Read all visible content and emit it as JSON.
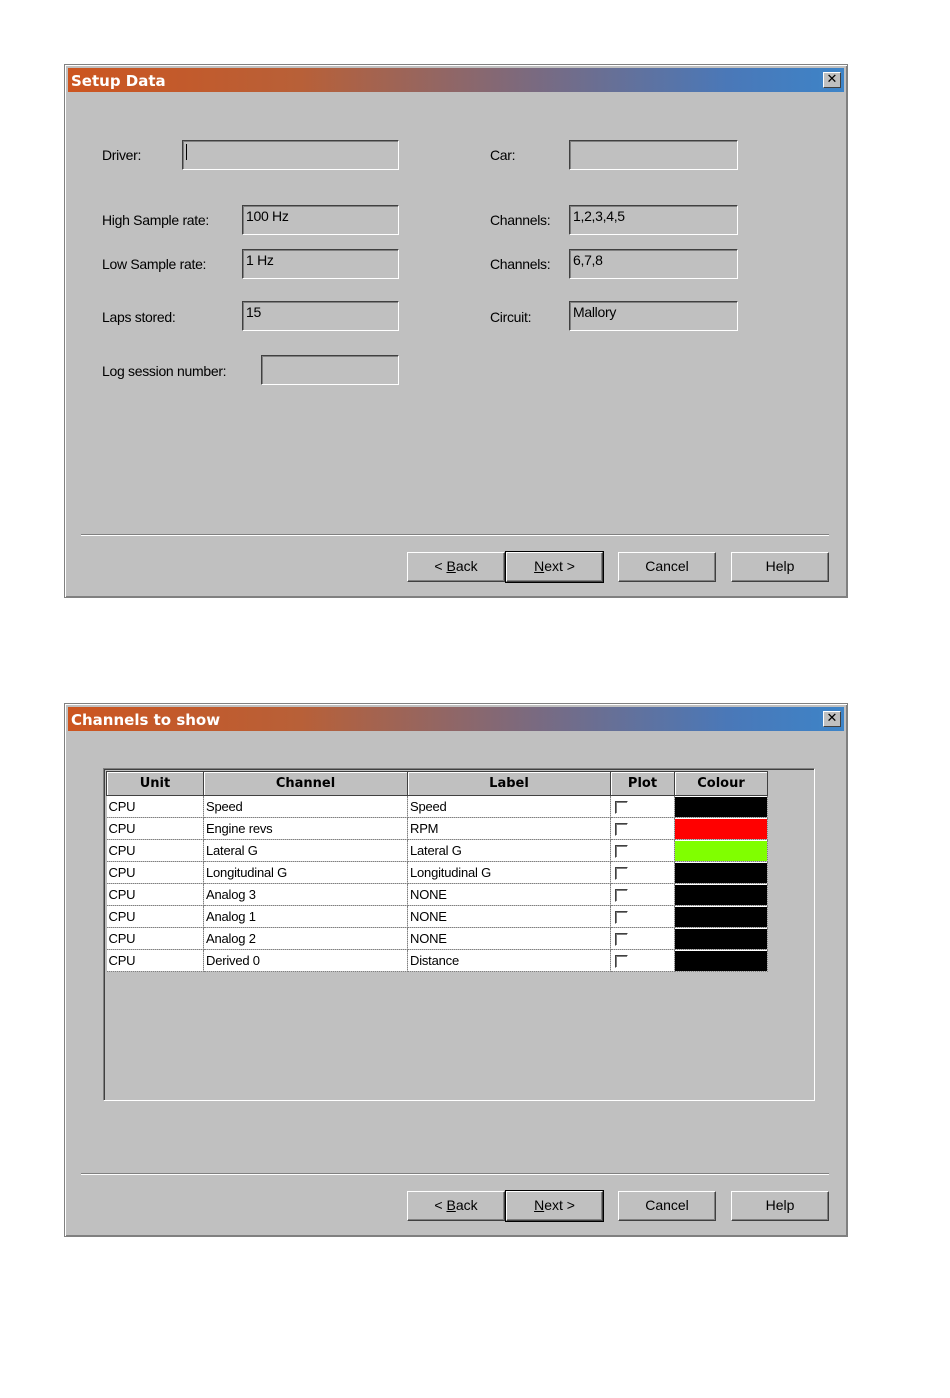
{
  "setup_dialog": {
    "title": "Setup Data",
    "close_glyph": "✕",
    "fields": {
      "driver": {
        "label": "Driver:",
        "value": ""
      },
      "car": {
        "label": "Car:",
        "value": ""
      },
      "high_sample_rate": {
        "label": "High Sample rate:",
        "value": "100 Hz"
      },
      "high_channels": {
        "label": "Channels:",
        "value": "1,2,3,4,5"
      },
      "low_sample_rate": {
        "label": "Low Sample rate:",
        "value": "1 Hz"
      },
      "low_channels": {
        "label": "Channels:",
        "value": "6,7,8"
      },
      "laps_stored": {
        "label": "Laps stored:",
        "value": "15"
      },
      "circuit": {
        "label": "Circuit:",
        "value": "Mallory"
      },
      "log_session_number": {
        "label": "Log session number:",
        "value": ""
      }
    },
    "buttons": {
      "back": {
        "pre": "< ",
        "accel": "B",
        "post": "ack"
      },
      "next": {
        "pre": "",
        "accel": "N",
        "post": "ext >"
      },
      "cancel": "Cancel",
      "help": "Help"
    }
  },
  "channels_dialog": {
    "title": "Channels to show",
    "close_glyph": "✕",
    "columns": [
      "Unit",
      "Channel",
      "Label",
      "Plot",
      "Colour"
    ],
    "rows": [
      {
        "unit": "CPU",
        "channel": "Speed",
        "label": "Speed",
        "plot": false,
        "colour": "#000000"
      },
      {
        "unit": "CPU",
        "channel": "Engine revs",
        "label": "RPM",
        "plot": false,
        "colour": "#ff0000"
      },
      {
        "unit": "CPU",
        "channel": "Lateral G",
        "label": "Lateral G",
        "plot": false,
        "colour": "#80ff00"
      },
      {
        "unit": "CPU",
        "channel": "Longitudinal G",
        "label": "Longitudinal G",
        "plot": false,
        "colour": "#000000"
      },
      {
        "unit": "CPU",
        "channel": "Analog 3",
        "label": "NONE",
        "plot": false,
        "colour": "#000000"
      },
      {
        "unit": "CPU",
        "channel": "Analog 1",
        "label": "NONE",
        "plot": false,
        "colour": "#000000"
      },
      {
        "unit": "CPU",
        "channel": "Analog 2",
        "label": "NONE",
        "plot": false,
        "colour": "#000000"
      },
      {
        "unit": "CPU",
        "channel": "Derived 0",
        "label": "Distance",
        "plot": false,
        "colour": "#000000"
      }
    ],
    "buttons": {
      "back": {
        "pre": "< ",
        "accel": "B",
        "post": "ack"
      },
      "next": {
        "pre": "",
        "accel": "N",
        "post": "ext >"
      },
      "cancel": "Cancel",
      "help": "Help"
    }
  }
}
